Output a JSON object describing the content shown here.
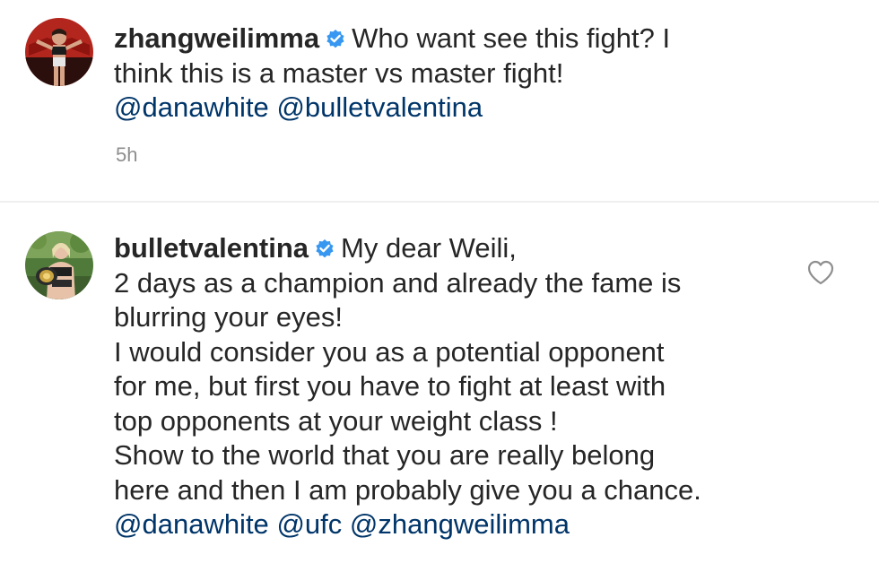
{
  "comments": [
    {
      "username": "zhangweilimma",
      "verified_icon": "verified-badge-icon",
      "lines": [
        "Who want see this fight? I",
        "think this is a master vs master fight!"
      ],
      "mentions": [
        "@danawhite",
        "@bulletvalentina"
      ],
      "time": "5h"
    },
    {
      "username": "bulletvalentina",
      "verified_icon": "verified-badge-icon",
      "lines": [
        "My dear Weili,",
        "2 days as a champion and already the fame is",
        "blurring your eyes!",
        "I would consider you as a potential opponent",
        "for me, but first you have to fight at least with",
        "top opponents  at your weight class !",
        "Show to the world that you are really belong",
        "here and then I am probably give you a chance."
      ],
      "mentions": [
        "@danawhite",
        "@ufc",
        "@zhangweilimma"
      ],
      "like_icon": "heart-icon"
    }
  ],
  "colors": {
    "text": "#262626",
    "mention": "#003569",
    "meta": "#8e8e8e",
    "verified": "#3897f0",
    "divider": "#efefef"
  }
}
